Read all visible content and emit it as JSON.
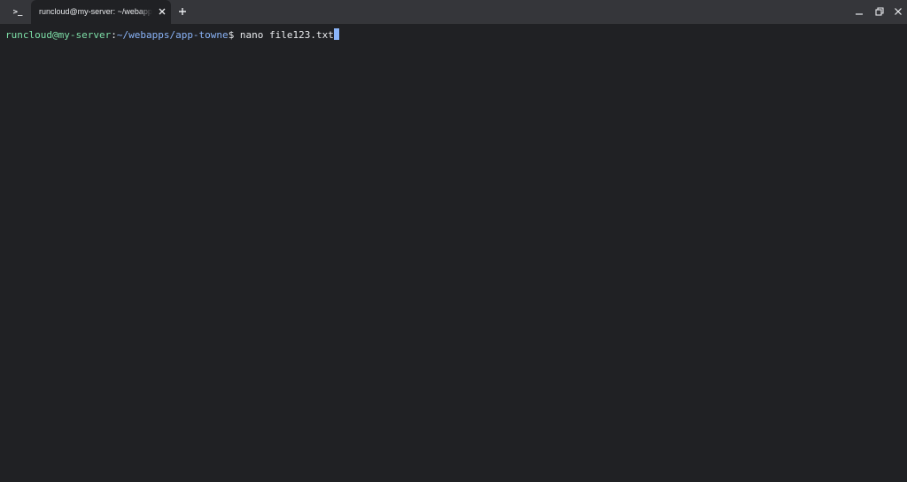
{
  "titlebar": {
    "app_icon": "terminal-icon",
    "tab": {
      "title": "runcloud@my-server: ~/webapps/app-towne"
    },
    "icons": {
      "tab_close": "close-icon",
      "new_tab": "plus-icon",
      "minimize": "minimize-icon",
      "restore": "restore-icon",
      "close": "close-icon"
    }
  },
  "terminal": {
    "prompt": {
      "user_host": "runcloud@my-server",
      "separator": ":",
      "path": "~/webapps/app-towne",
      "symbol": "$"
    },
    "command": " nano file123.txt"
  },
  "colors": {
    "background": "#202124",
    "titlebar": "#35363a",
    "user_host": "#7ee0a8",
    "path": "#8ab4f8",
    "text": "#e8eaed",
    "cursor": "#8ab4f8"
  }
}
